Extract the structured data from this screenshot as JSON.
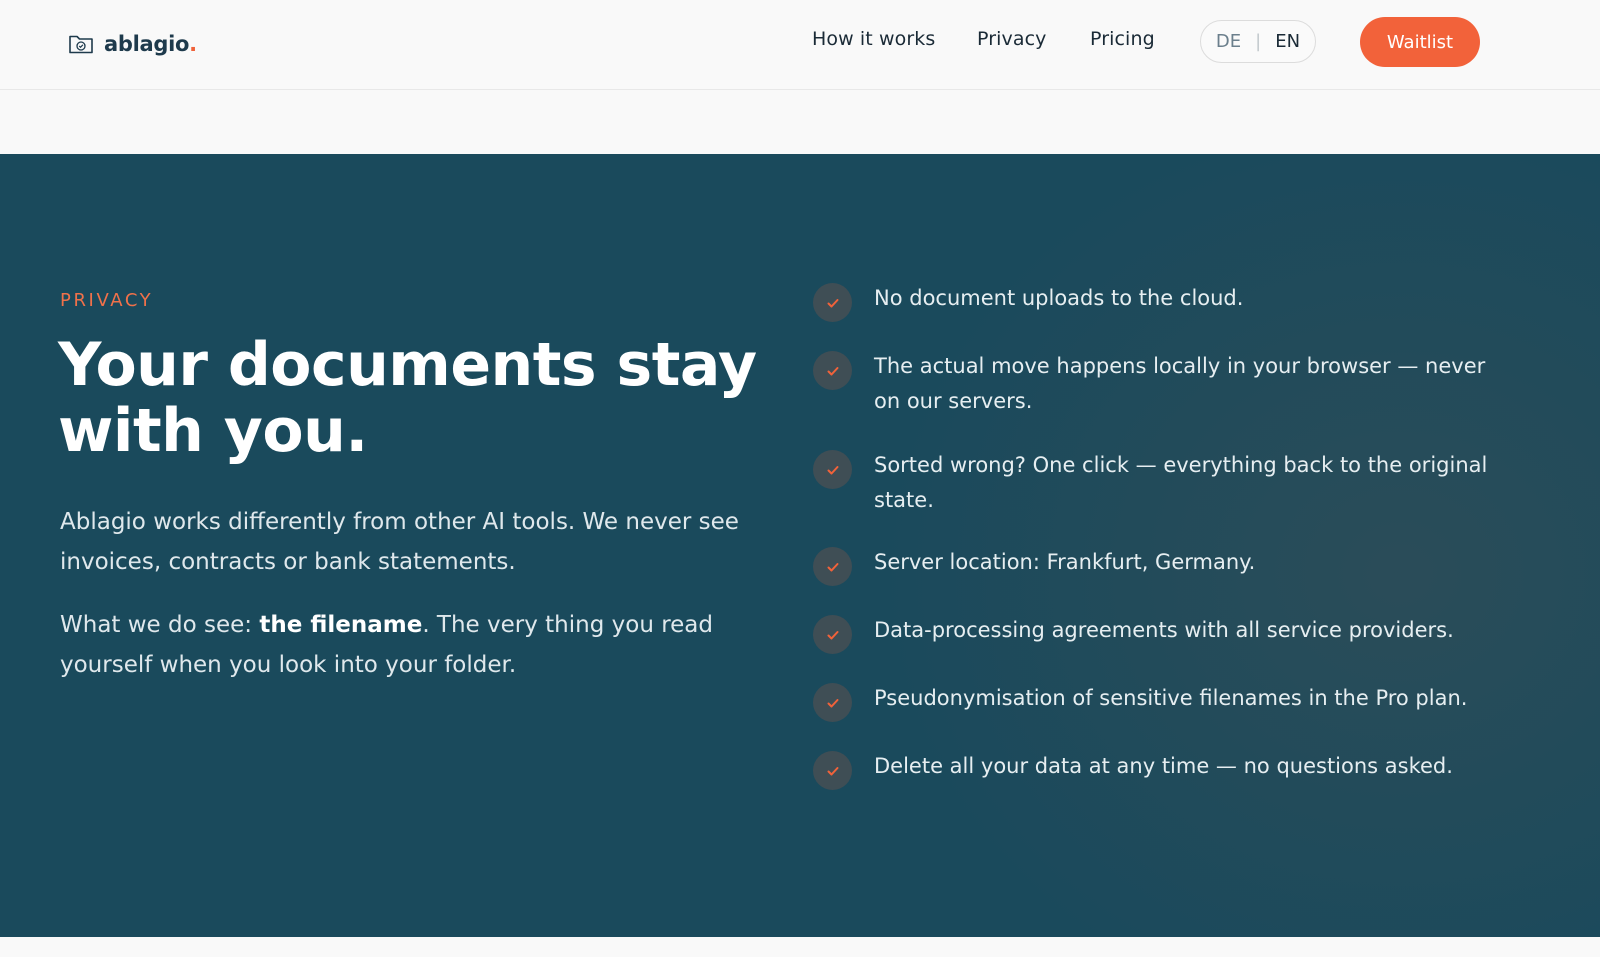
{
  "header": {
    "logo_text": "ablagio",
    "logo_dot": ".",
    "logo_icon": "folder-check-icon",
    "nav": {
      "how_it_works": "How it works",
      "privacy": "Privacy",
      "pricing": "Pricing"
    },
    "lang": {
      "de": "DE",
      "separator": "|",
      "en": "EN",
      "active": "EN"
    },
    "waitlist_label": "Waitlist"
  },
  "privacy": {
    "eyebrow": "PRIVACY",
    "headline": "Your documents stay with you.",
    "paragraph_1": "Ablagio works differently from other AI tools. We never see invoices, contracts or bank statements.",
    "paragraph_2_before": "What we do see: ",
    "paragraph_2_bold": "the filename",
    "paragraph_2_after": ". The very thing you read yourself when you look into your folder.",
    "features": [
      "No document uploads to the cloud.",
      "The actual move happens locally in your browser — never on our servers.",
      "Sorted wrong? One click — everything back to the original state.",
      "Server location: Frankfurt, Germany.",
      "Data-processing agreements with all service providers.",
      "Pseudonymisation of sensitive filenames in the Pro plan.",
      "Delete all your data at any time — no questions asked."
    ],
    "check_icon": "check-icon"
  },
  "colors": {
    "accent": "#f2623a",
    "section_bg": "#1a4a5c",
    "heading": "#ffffff",
    "brand_text": "#1e3a4c"
  }
}
